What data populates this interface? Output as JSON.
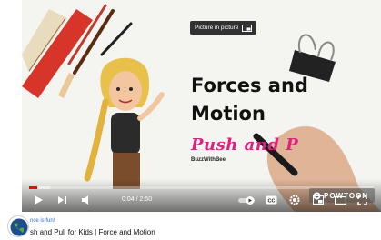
{
  "pip_tooltip": {
    "label": "Picture in picture"
  },
  "video": {
    "title_line1": "Forces and",
    "title_line2": "Motion",
    "push_pull_text": "Push and P",
    "brand": "BuzzWithBee"
  },
  "controls": {
    "time": "0:04 / 2:50",
    "progress_fraction": 0.025,
    "buffered_fraction": 0.06,
    "cc_label": "CC",
    "watermark": "POWTOON"
  },
  "meta": {
    "channel": "nce is fun!",
    "video_title": "sh and Pull for Kids | Force and Motion"
  },
  "colors": {
    "progress": "#ff0000",
    "push_pull": "#d8257f",
    "channel_link": "#2a6fd6"
  },
  "icons": [
    "play-icon",
    "next-icon",
    "volume-icon",
    "autoplay-toggle-icon",
    "cc-icon",
    "settings-icon",
    "miniplayer-icon",
    "theater-icon",
    "fullscreen-icon",
    "pip-icon"
  ]
}
